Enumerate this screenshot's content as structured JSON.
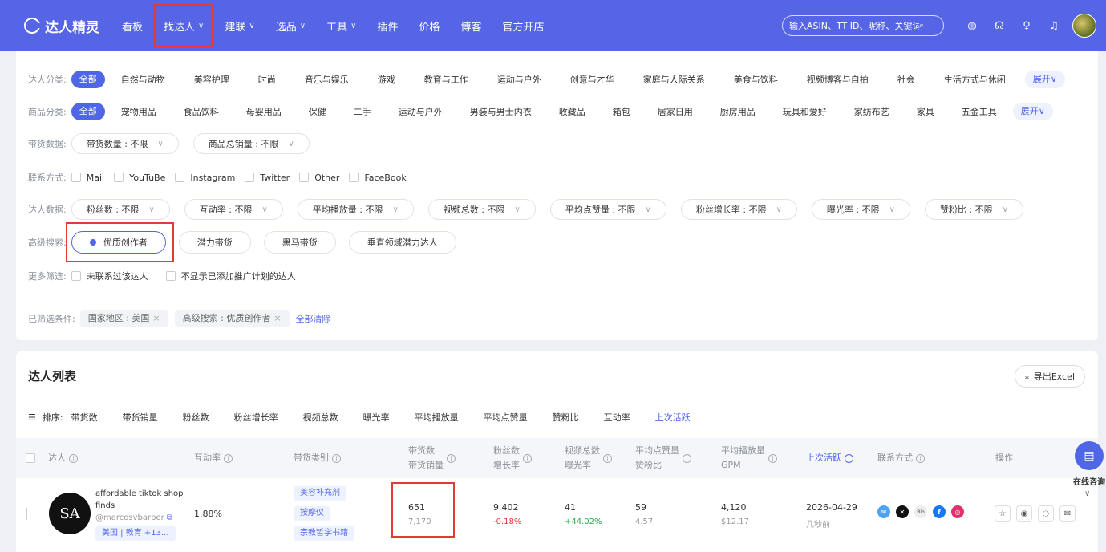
{
  "nav": {
    "logo": "达人精灵",
    "items": [
      {
        "label": "看板",
        "chev": false
      },
      {
        "label": "找达人",
        "chev": true
      },
      {
        "label": "建联",
        "chev": true
      },
      {
        "label": "选品",
        "chev": true
      },
      {
        "label": "工具",
        "chev": true
      },
      {
        "label": "插件",
        "chev": false
      },
      {
        "label": "价格",
        "chev": false
      },
      {
        "label": "博客",
        "chev": false
      },
      {
        "label": "官方开店",
        "chev": false
      }
    ],
    "search_placeholder": "输入ASIN、TT ID、昵称、关键词"
  },
  "filters": {
    "creator_label": "达人分类:",
    "all": "全部",
    "creator_cats": [
      "自然与动物",
      "美容护理",
      "时尚",
      "音乐与娱乐",
      "游戏",
      "教育与工作",
      "运动与户外",
      "创意与才华",
      "家庭与人际关系",
      "美食与饮料",
      "视频博客与自拍",
      "社会",
      "生活方式与休闲"
    ],
    "expand": "展开∨",
    "product_label": "商品分类:",
    "product_cats": [
      "宠物用品",
      "食品饮料",
      "母婴用品",
      "保健",
      "二手",
      "运动与户外",
      "男装与男士内衣",
      "收藏品",
      "箱包",
      "居家日用",
      "厨房用品",
      "玩具和爱好",
      "家纺布艺",
      "家具",
      "五金工具"
    ],
    "sales_label": "带货数据:",
    "sales_dd": [
      "带货数量 : 不限",
      "商品总销量 : 不限"
    ],
    "contact_label": "联系方式:",
    "contacts": [
      "Mail",
      "YouTuBe",
      "Instagram",
      "Twitter",
      "Other",
      "FaceBook"
    ],
    "creator_data_label": "达人数据:",
    "creator_dd": [
      "粉丝数 : 不限",
      "互动率 : 不限",
      "平均播放量 : 不限",
      "视频总数 : 不限",
      "平均点赞量 : 不限",
      "粉丝增长率 : 不限",
      "曝光率 : 不限",
      "赞粉比 : 不限"
    ],
    "adv_label": "高级搜索:",
    "adv": [
      "优质创作者",
      "潜力带货",
      "黑马带货",
      "垂直领域潜力达人"
    ],
    "more_label": "更多筛选:",
    "more": [
      "未联系过该达人",
      "不显示已添加推广计划的达人"
    ],
    "selected_label": "已筛选条件:",
    "selected": [
      "国家地区 : 美国",
      "高级搜索 : 优质创作者"
    ],
    "clear": "全部清除"
  },
  "list": {
    "title": "达人列表",
    "export": "导出Excel",
    "sort_label": "排序:",
    "sorts": [
      "带货数",
      "带货销量",
      "粉丝数",
      "粉丝增长率",
      "视频总数",
      "曝光率",
      "平均播放量",
      "平均点赞量",
      "赞粉比",
      "互动率",
      "上次活跃"
    ],
    "headers": {
      "creator": "达人",
      "engagement": "互动率",
      "category": "带货类别",
      "sales1": "带货数",
      "sales2": "带货销量",
      "fans1": "粉丝数",
      "fans2": "增长率",
      "video1": "视频总数",
      "video2": "曝光率",
      "likes1": "平均点赞量",
      "likes2": "赞粉比",
      "play1": "平均播放量",
      "play2": "GPM",
      "last": "上次活跃",
      "contact": "联系方式",
      "ops": "操作"
    },
    "row": {
      "avatar_text": "SA",
      "name": "affordable tiktok shop finds",
      "handle": "@marcosvbarber",
      "region_tag": "美国 | 教育 +13...",
      "engagement": "1.88%",
      "categories": [
        "美容补充剂",
        "按摩仪",
        "宗教哲学书籍"
      ],
      "sales_count": "651",
      "sales_volume": "7,170",
      "fans": "9,402",
      "fans_growth": "-0.18%",
      "videos": "41",
      "exposure": "+44.02%",
      "avg_likes": "59",
      "like_fan_ratio": "4.57",
      "avg_play": "4,120",
      "gpm": "$12.17",
      "last_active": "2026-04-29",
      "last_active_rel": "几秒前"
    }
  },
  "float": {
    "label": "在线咨询"
  }
}
